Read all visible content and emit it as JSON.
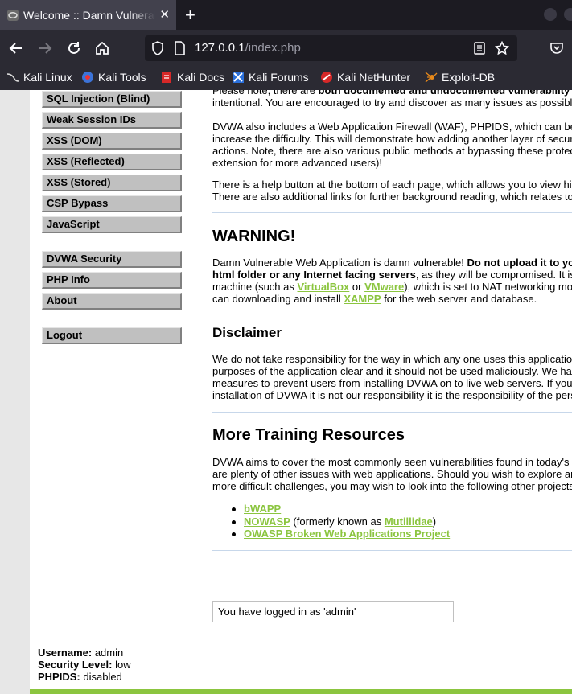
{
  "browser": {
    "tab_title": "Welcome :: Damn Vulnerable Web Application",
    "url_host": "127.0.0.1",
    "url_path": "/index.php",
    "bookmarks": [
      "Kali Linux",
      "Kali Tools",
      "Kali Docs",
      "Kali Forums",
      "Kali NetHunter",
      "Exploit-DB"
    ]
  },
  "menu": {
    "group1": [
      "SQL Injection (Blind)",
      "Weak Session IDs",
      "XSS (DOM)",
      "XSS (Reflected)",
      "XSS (Stored)",
      "CSP Bypass",
      "JavaScript"
    ],
    "group2": [
      "DVWA Security",
      "PHP Info",
      "About"
    ],
    "group3": [
      "Logout"
    ]
  },
  "content": {
    "intro_l1_a": "Please note, there are ",
    "intro_l1_b": "both documented and undocumented vulnerability",
    "intro_l2": "intentional. You are encouraged to try and discover as many issues as possibl",
    "waf_l1": "DVWA also includes a Web Application Firewall (WAF), PHPIDS, which can be",
    "waf_l2": "increase the difficulty. This will demonstrate how adding another layer of secur",
    "waf_l3": "actions. Note, there are also various public methods at bypassing these protec",
    "waf_l4": "extension for more advanced users)!",
    "help_l1": "There is a help button at the bottom of each page, which allows you to view hi",
    "help_l2": "There are also additional links for further background reading, which relates to",
    "warning_title": "WARNING!",
    "warn_l1_a": "Damn Vulnerable Web Application is damn vulnerable! ",
    "warn_l1_b": "Do not upload it to yo",
    "warn_l2_a": "html folder or any Internet facing servers",
    "warn_l2_b": ", as they will be compromised. It is",
    "warn_l3_a": "machine (such as ",
    "warn_l3_link1": "VirtualBox",
    "warn_l3_b": " or ",
    "warn_l3_link2": "VMware",
    "warn_l3_c": "), which is set to NAT networking mo",
    "warn_l4_a": "can downloading and install ",
    "warn_l4_link": "XAMPP",
    "warn_l4_b": " for the web server and database.",
    "disclaimer_title": "Disclaimer",
    "disc_l1": "We do not take responsibility for the way in which any one uses this applicatio",
    "disc_l2": "purposes of the application clear and it should not be used maliciously. We ha",
    "disc_l3": "measures to prevent users from installing DVWA on to live web servers. If you",
    "disc_l4": "installation of DVWA it is not our responsibility it is the responsibility of the pers",
    "training_title": "More Training Resources",
    "train_l1": "DVWA aims to cover the most commonly seen vulnerabilities found in today's",
    "train_l2": "are plenty of other issues with web applications. Should you wish to explore ar",
    "train_l3": "more difficult challenges, you may wish to look into the following other projects",
    "res1": "bWAPP",
    "res2_link": "NOWASP",
    "res2_mid": " (formerly known as ",
    "res2_link2": "Mutillidae",
    "res2_end": ")",
    "res3": "OWASP Broken Web Applications Project"
  },
  "status": {
    "logged_in": "You have logged in as 'admin'",
    "username_label": "Username:",
    "username": "admin",
    "security_label": "Security Level:",
    "security": "low",
    "phpids_label": "PHPIDS:",
    "phpids": "disabled"
  }
}
